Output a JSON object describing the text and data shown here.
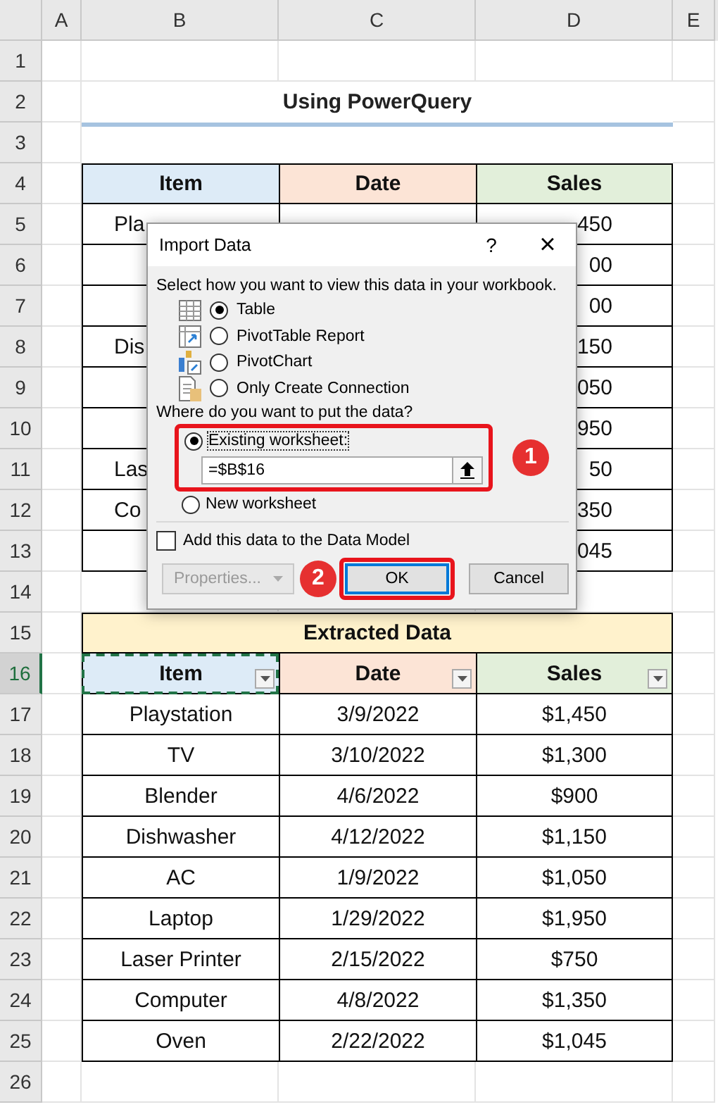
{
  "column_headers": [
    "A",
    "B",
    "C",
    "D",
    "E"
  ],
  "row_headers": [
    {
      "label": "1",
      "selected": false
    },
    {
      "label": "2",
      "selected": false
    },
    {
      "label": "3",
      "selected": false
    },
    {
      "label": "4",
      "selected": false
    },
    {
      "label": "5",
      "selected": false
    },
    {
      "label": "6",
      "selected": false
    },
    {
      "label": "7",
      "selected": false
    },
    {
      "label": "8",
      "selected": false
    },
    {
      "label": "9",
      "selected": false
    },
    {
      "label": "10",
      "selected": false
    },
    {
      "label": "11",
      "selected": false
    },
    {
      "label": "12",
      "selected": false
    },
    {
      "label": "13",
      "selected": false
    },
    {
      "label": "14",
      "selected": false
    },
    {
      "label": "15",
      "selected": false
    },
    {
      "label": "16",
      "selected": true
    },
    {
      "label": "17",
      "selected": false
    },
    {
      "label": "18",
      "selected": false
    },
    {
      "label": "19",
      "selected": false
    },
    {
      "label": "20",
      "selected": false
    },
    {
      "label": "21",
      "selected": false
    },
    {
      "label": "22",
      "selected": false
    },
    {
      "label": "23",
      "selected": false
    },
    {
      "label": "24",
      "selected": false
    },
    {
      "label": "25",
      "selected": false
    },
    {
      "label": "26",
      "selected": false
    }
  ],
  "source_table": {
    "title": "Using PowerQuery",
    "columns": [
      "Item",
      "Date",
      "Sales"
    ],
    "rows": [
      {
        "item": "Pla",
        "sales": "450"
      },
      {
        "sales": "00"
      },
      {
        "sales": "00"
      },
      {
        "item": "Dis",
        "sales": "150"
      },
      {
        "sales": "050"
      },
      {
        "sales": "950"
      },
      {
        "item": "Las",
        "sales": "50"
      },
      {
        "item": "Co",
        "sales": "350"
      },
      {
        "sales": "045"
      }
    ]
  },
  "extracted_table": {
    "title": "Extracted Data",
    "columns": [
      {
        "label": "Item",
        "selected": true
      },
      {
        "label": "Date",
        "selected": false
      },
      {
        "label": "Sales",
        "selected": false
      }
    ],
    "rows": [
      [
        "Playstation",
        "3/9/2022",
        "$1,450"
      ],
      [
        "TV",
        "3/10/2022",
        "$1,300"
      ],
      [
        "Blender",
        "4/6/2022",
        "$900"
      ],
      [
        "Dishwasher",
        "4/12/2022",
        "$1,150"
      ],
      [
        "AC",
        "1/9/2022",
        "$1,050"
      ],
      [
        "Laptop",
        "1/29/2022",
        "$1,950"
      ],
      [
        "Laser Printer",
        "2/15/2022",
        "$750"
      ],
      [
        "Computer",
        "4/8/2022",
        "$1,350"
      ],
      [
        "Oven",
        "2/22/2022",
        "$1,045"
      ]
    ]
  },
  "dialog": {
    "title": "Import Data",
    "help": "?",
    "close": "×",
    "view_prompt": "Select how you want to view this data in your workbook.",
    "view_options": [
      {
        "kind": "table",
        "label": "Table",
        "selected": true
      },
      {
        "kind": "pivot_table",
        "label": "PivotTable Report",
        "selected": false
      },
      {
        "kind": "pivot_chart",
        "label": "PivotChart",
        "selected": false
      },
      {
        "kind": "connection",
        "label": "Only Create Connection",
        "selected": false
      }
    ],
    "location_prompt": "Where do you want to put the data?",
    "location_options": [
      {
        "kind": "existing",
        "label": "Existing worksheet:",
        "selected": true,
        "highlighted": true,
        "marker": "1",
        "value": "=$B$16"
      },
      {
        "kind": "new",
        "label": "New worksheet",
        "selected": false
      }
    ],
    "data_model": {
      "label": "Add this data to the Data Model",
      "checked": false
    },
    "buttons": [
      {
        "kind": "properties",
        "label": "Properties...",
        "disabled": true
      },
      {
        "kind": "ok",
        "label": "OK",
        "default": true,
        "highlighted": true,
        "marker": "2"
      },
      {
        "kind": "cancel",
        "label": "Cancel"
      }
    ]
  }
}
